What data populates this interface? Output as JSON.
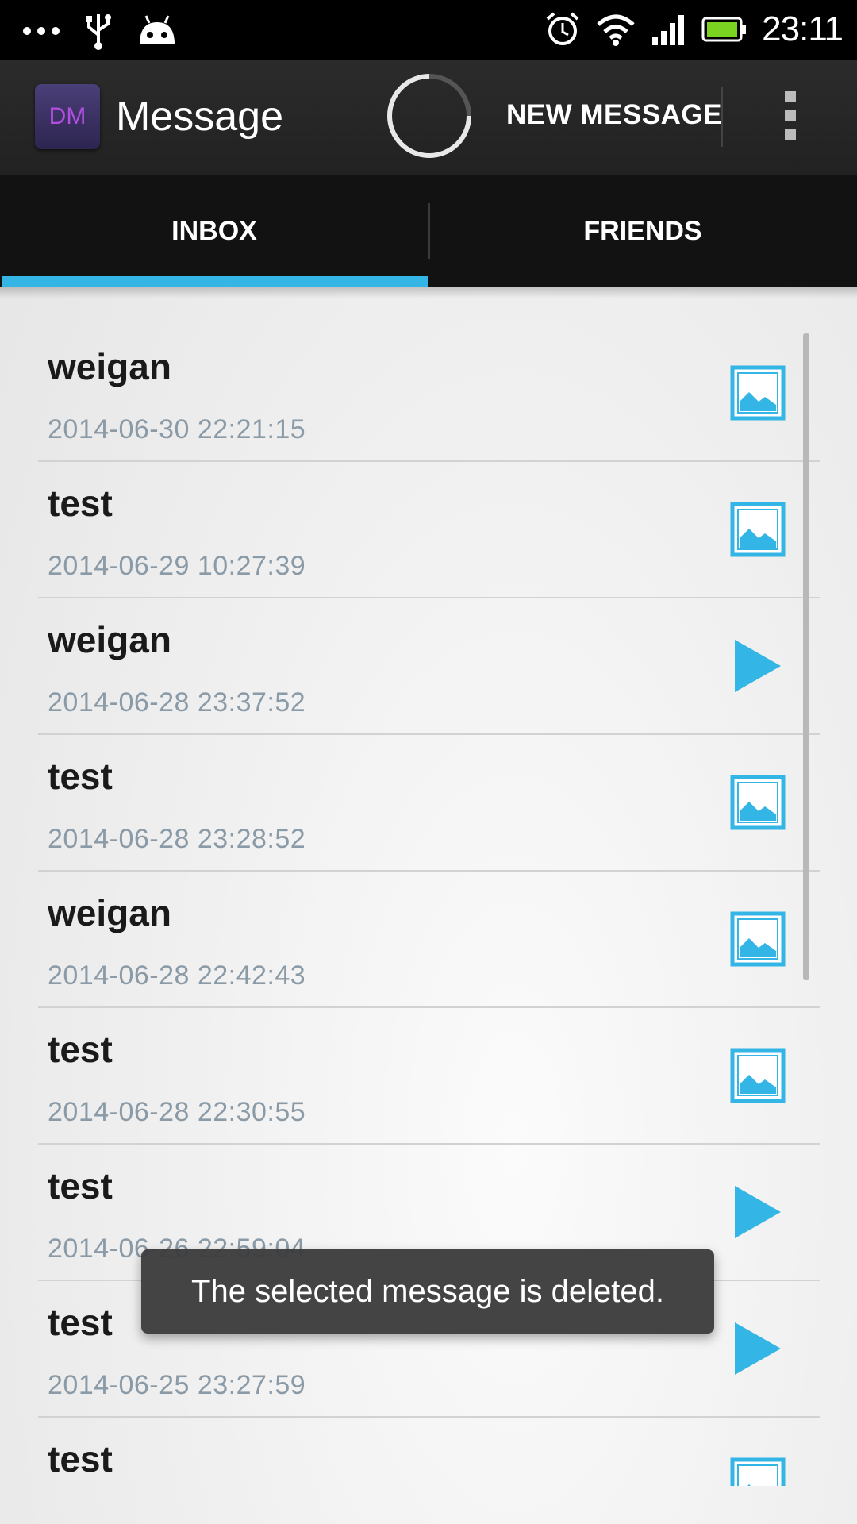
{
  "status_bar": {
    "time": "23:11",
    "left_icons": [
      "more-dots-icon",
      "usb-icon",
      "android-icon"
    ],
    "right_icons": [
      "alarm-icon",
      "wifi-icon",
      "signal-icon",
      "battery-icon"
    ]
  },
  "action_bar": {
    "app_icon_text": "DM",
    "title": "Message",
    "new_message_label": "NEW MESSAGE"
  },
  "tabs": [
    {
      "label": "INBOX",
      "active": true
    },
    {
      "label": "FRIENDS",
      "active": false
    }
  ],
  "messages": [
    {
      "sender": "weigan",
      "date": "2014-06-30 22:21:15",
      "type": "image-icon"
    },
    {
      "sender": "test",
      "date": "2014-06-29 10:27:39",
      "type": "image-icon"
    },
    {
      "sender": "weigan",
      "date": "2014-06-28 23:37:52",
      "type": "play-icon"
    },
    {
      "sender": "test",
      "date": "2014-06-28 23:28:52",
      "type": "image-icon"
    },
    {
      "sender": "weigan",
      "date": "2014-06-28 22:42:43",
      "type": "image-icon"
    },
    {
      "sender": "test",
      "date": "2014-06-28 22:30:55",
      "type": "image-icon"
    },
    {
      "sender": "test",
      "date": "2014-06-26 22:59:04",
      "type": "play-icon"
    },
    {
      "sender": "test",
      "date": "2014-06-25 23:27:59",
      "type": "play-icon"
    },
    {
      "sender": "test",
      "date": "",
      "type": "image-icon"
    }
  ],
  "toast": {
    "text": "The selected message is deleted."
  },
  "colors": {
    "accent": "#33b5e5",
    "date_text": "#8a9aa6"
  }
}
